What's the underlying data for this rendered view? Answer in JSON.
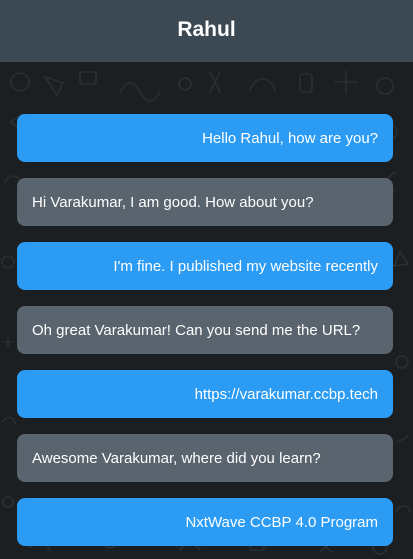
{
  "header": {
    "title": "Rahul"
  },
  "colors": {
    "header_bg": "#3c4852",
    "sent_bubble": "#2b9bf4",
    "received_bubble": "#59646e",
    "background": "#1c1f22"
  },
  "messages": [
    {
      "type": "sent",
      "text": "Hello Rahul, how are you?"
    },
    {
      "type": "received",
      "text": "Hi Varakumar, I am good. How about you?"
    },
    {
      "type": "sent",
      "text": "I'm fine. I published my website recently"
    },
    {
      "type": "received",
      "text": "Oh great Varakumar! Can you send me the URL?"
    },
    {
      "type": "sent",
      "text": "https://varakumar.ccbp.tech"
    },
    {
      "type": "received",
      "text": "Awesome Varakumar, where did you learn?"
    },
    {
      "type": "sent",
      "text": "NxtWave CCBP 4.0 Program"
    }
  ]
}
